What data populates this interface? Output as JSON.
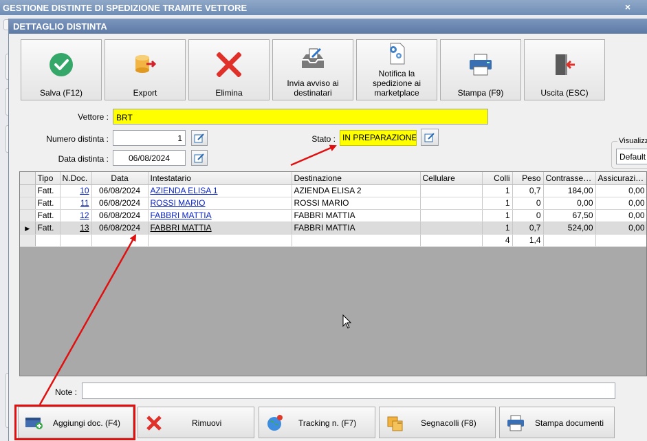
{
  "outer_window": {
    "title": "GESTIONE DISTINTE DI SPEDIZIONE TRAMITE VETTORE",
    "close_glyph": "×"
  },
  "dialog": {
    "title": "DETTAGLIO DISTINTA"
  },
  "toolbar": {
    "save_label": "Salva (F12)",
    "export_label": "Export",
    "delete_label": "Elimina",
    "notify_label": "Invia avviso ai destinatari",
    "marketplace_label": "Notifica la spedizione ai marketplace",
    "print_label": "Stampa (F9)",
    "exit_label": "Uscita (ESC)"
  },
  "form": {
    "vettore_label": "Vettore :",
    "vettore_value": "BRT",
    "numero_label": "Numero distinta :",
    "numero_value": "1",
    "data_label": "Data distinta :",
    "data_value": "06/08/2024",
    "stato_label": "Stato :",
    "stato_value": "IN PREPARAZIONE",
    "visualizza_label": "Visualizza",
    "visualizza_value": "Default"
  },
  "grid": {
    "columns": [
      "Tipo",
      "N.Doc.",
      "Data",
      "Intestatario",
      "Destinazione",
      "Cellulare",
      "Colli",
      "Peso",
      "Contrasse…",
      "Assicurazi…"
    ],
    "rows": [
      {
        "tipo": "Fatt.",
        "ndoc": "10",
        "data": "06/08/2024",
        "intestatario": "AZIENDA ELISA 1",
        "destinazione": "AZIENDA ELISA 2",
        "cellulare": "",
        "colli": "1",
        "peso": "0,7",
        "contrassegno": "184,00",
        "assicurazione": "0,00"
      },
      {
        "tipo": "Fatt.",
        "ndoc": "11",
        "data": "06/08/2024",
        "intestatario": "ROSSI MARIO",
        "destinazione": "ROSSI MARIO",
        "cellulare": "",
        "colli": "1",
        "peso": "0",
        "contrassegno": "0,00",
        "assicurazione": "0,00"
      },
      {
        "tipo": "Fatt.",
        "ndoc": "12",
        "data": "06/08/2024",
        "intestatario": "FABBRI MATTIA",
        "destinazione": "FABBRI MATTIA",
        "cellulare": "",
        "colli": "1",
        "peso": "0",
        "contrassegno": "67,50",
        "assicurazione": "0,00"
      },
      {
        "tipo": "Fatt.",
        "ndoc": "13",
        "data": "06/08/2024",
        "intestatario": "FABBRI MATTIA",
        "destinazione": "FABBRI MATTIA",
        "cellulare": "",
        "colli": "1",
        "peso": "0,7",
        "contrassegno": "524,00",
        "assicurazione": "0,00"
      }
    ],
    "totals": {
      "colli": "4",
      "peso": "1,4"
    }
  },
  "note": {
    "label": "Note :",
    "value": ""
  },
  "bottom_buttons": {
    "add_label": "Aggiungi doc. (F4)",
    "remove_label": "Rimuovi",
    "tracking_label": "Tracking n. (F7)",
    "labels_label": "Segnacolli (F8)",
    "print_docs_label": "Stampa documenti"
  },
  "colors": {
    "highlight_yellow": "#ffff00",
    "annotation_red": "#e01010",
    "link_blue": "#0a24c9"
  }
}
